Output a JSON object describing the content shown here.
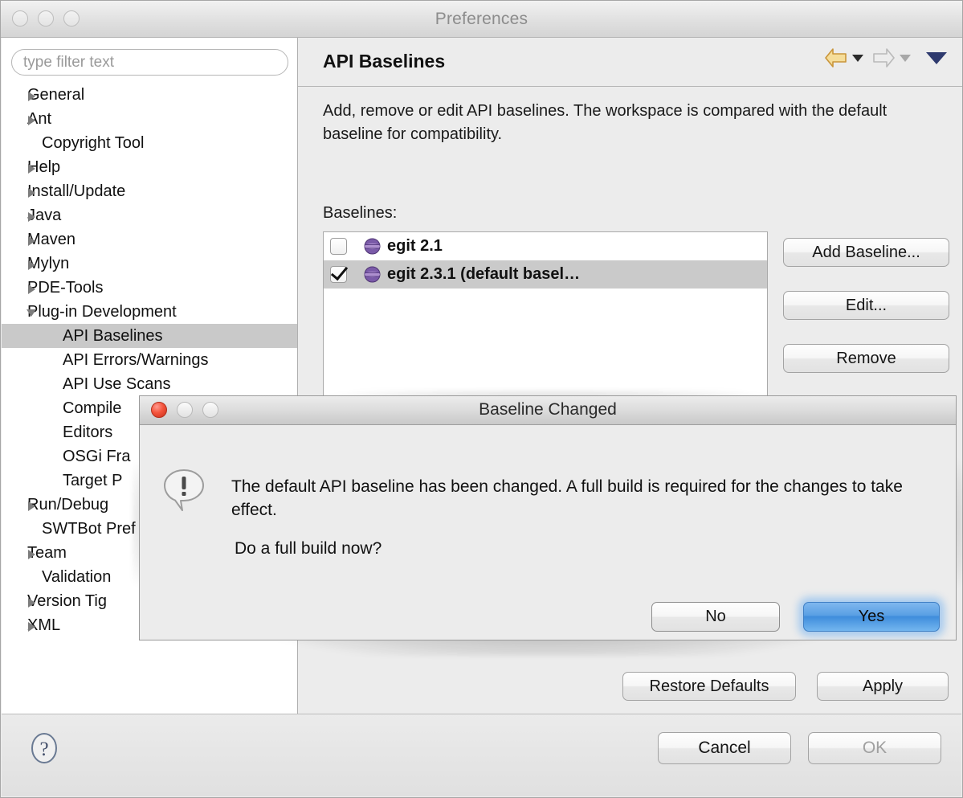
{
  "window": {
    "title": "Preferences",
    "traffic_lights": [
      "close-button",
      "minimize-button",
      "zoom-button"
    ]
  },
  "sidebar": {
    "filter": {
      "value": "",
      "placeholder": "type filter text"
    },
    "items": [
      {
        "label": "General",
        "arrow": "collapsed",
        "level": 0
      },
      {
        "label": "Ant",
        "arrow": "collapsed",
        "level": 0
      },
      {
        "label": "Copyright Tool",
        "arrow": "none",
        "level": 0
      },
      {
        "label": "Help",
        "arrow": "collapsed",
        "level": 0
      },
      {
        "label": "Install/Update",
        "arrow": "collapsed",
        "level": 0
      },
      {
        "label": "Java",
        "arrow": "collapsed",
        "level": 0
      },
      {
        "label": "Maven",
        "arrow": "collapsed",
        "level": 0
      },
      {
        "label": "Mylyn",
        "arrow": "collapsed",
        "level": 0
      },
      {
        "label": "PDE-Tools",
        "arrow": "collapsed",
        "level": 0
      },
      {
        "label": "Plug-in Development",
        "arrow": "expanded",
        "level": 0
      },
      {
        "label": "API Baselines",
        "arrow": "none",
        "level": 1,
        "selected": true
      },
      {
        "label": "API Errors/Warnings",
        "arrow": "none",
        "level": 1
      },
      {
        "label": "API Use Scans",
        "arrow": "none",
        "level": 1
      },
      {
        "label": "Compile",
        "arrow": "none",
        "level": 1
      },
      {
        "label": "Editors",
        "arrow": "none",
        "level": 1
      },
      {
        "label": "OSGi Fra",
        "arrow": "none",
        "level": 1
      },
      {
        "label": "Target P",
        "arrow": "none",
        "level": 1
      },
      {
        "label": "Run/Debug",
        "arrow": "collapsed",
        "level": 0
      },
      {
        "label": "SWTBot Pref",
        "arrow": "none",
        "level": 0
      },
      {
        "label": "Team",
        "arrow": "collapsed",
        "level": 0
      },
      {
        "label": "Validation",
        "arrow": "none",
        "level": 0
      },
      {
        "label": "Version Tig",
        "arrow": "collapsed",
        "level": 0
      },
      {
        "label": "XML",
        "arrow": "collapsed",
        "level": 0
      }
    ]
  },
  "page": {
    "title": "API Baselines",
    "nav": {
      "back_icon": "back-arrow-icon",
      "forward_icon": "forward-arrow-icon",
      "menu_icon": "dropdown-caret-icon",
      "back_enabled": true,
      "forward_enabled": false
    },
    "description": "Add, remove or edit API baselines. The workspace is compared with the default baseline for compatibility.",
    "baselines_label": "Baselines:",
    "baselines": [
      {
        "label": "egit 2.1",
        "checked": false,
        "selected": false,
        "icon": "plugin-sphere-icon"
      },
      {
        "label": "egit 2.3.1  (default basel…",
        "checked": true,
        "selected": true,
        "icon": "plugin-sphere-icon"
      }
    ],
    "buttons": {
      "add": "Add Baseline...",
      "edit": "Edit...",
      "remove": "Remove",
      "restore_defaults": "Restore Defaults",
      "apply": "Apply"
    }
  },
  "footer": {
    "help_icon": "help-question-icon",
    "cancel": "Cancel",
    "ok": "OK",
    "ok_enabled": false
  },
  "dialog": {
    "title": "Baseline Changed",
    "icon": "warning-speech-bubble-icon",
    "message": "The default API baseline has been changed. A full build is required for the changes to take effect.",
    "question": "Do a full build now?",
    "buttons": {
      "no": "No",
      "yes": "Yes"
    },
    "default_button": "Yes",
    "traffic_lights": [
      "close-button",
      "minimize-button",
      "zoom-button"
    ]
  },
  "colors": {
    "default_button": "#4f9ae0",
    "selection": "#c9c9c9",
    "plugin_icon": "#6f4d9e",
    "back_arrow": "#e8b84b"
  }
}
